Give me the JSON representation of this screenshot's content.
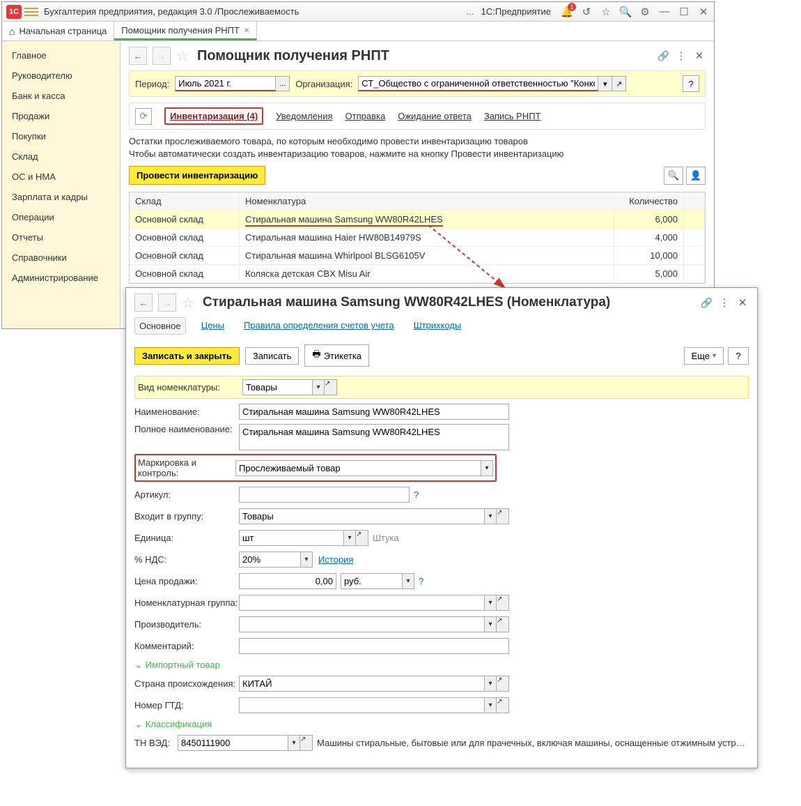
{
  "titlebar": {
    "app": "Бухгалтерия предприятия, редакция 3.0 /Прослеживаемость",
    "platform": "1С:Предприятие",
    "bell_count": "1"
  },
  "tabs": {
    "home": "Начальная страница",
    "t1": "Помощник получения РНПТ"
  },
  "sidebar": {
    "items": [
      "Главное",
      "Руководителю",
      "Банк и касса",
      "Продажи",
      "Покупки",
      "Склад",
      "ОС и НМА",
      "Зарплата и кадры",
      "Операции",
      "Отчеты",
      "Справочники",
      "Администрирование"
    ]
  },
  "page1": {
    "title": "Помощник получения РНПТ",
    "period_lbl": "Период:",
    "period_val": "Июль 2021 г.",
    "org_lbl": "Организация:",
    "org_val": "СТ_Общество с ограниченной ответственностью \"Конкорд\"",
    "tabs": {
      "inv": "Инвентаризация (4)",
      "notif": "Уведомления",
      "send": "Отправка",
      "wait": "Ожидание ответа",
      "rec": "Запись РНПТ"
    },
    "info1": "Остатки прослеживаемого товара, по которым необходимо провести инвентаризацию товаров",
    "info2": "Чтобы автоматически создать инвентаризацию товаров, нажмите на кнопку Провести инвентаризацию",
    "action": "Провести инвентаризацию",
    "cols": {
      "c1": "Склад",
      "c2": "Номенклатура",
      "c3": "Количество"
    },
    "rows": [
      {
        "c1": "Основной склад",
        "c2": "Стиральная машина Samsung WW80R42LHES",
        "c3": "6,000"
      },
      {
        "c1": "Основной склад",
        "c2": "Стиральная машина Haier HW80B14979S",
        "c3": "4,000"
      },
      {
        "c1": "Основной склад",
        "c2": "Стиральная машина Whirlpool BLSG6105V",
        "c3": "10,000"
      },
      {
        "c1": "Основной склад",
        "c2": "Коляска детская CBX Misu Air",
        "c3": "5,000"
      }
    ]
  },
  "page2": {
    "title": "Стиральная машина Samsung WW80R42LHES (Номенклатура)",
    "tabs": {
      "main": "Основное",
      "prices": "Цены",
      "rules": "Правила определения счетов учета",
      "barcodes": "Штрихкоды"
    },
    "cmd": {
      "saveclose": "Записать и закрыть",
      "save": "Записать",
      "label": "Этикетка",
      "more": "Еще",
      "help": "?"
    },
    "fields": {
      "vid_lbl": "Вид номенклатуры:",
      "vid_val": "Товары",
      "name_lbl": "Наименование:",
      "name_val": "Стиральная машина Samsung WW80R42LHES",
      "full_lbl": "Полное наименование:",
      "full_val": "Стиральная машина Samsung WW80R42LHES",
      "mark_lbl": "Маркировка и контроль:",
      "mark_val": "Прослеживаемый товар",
      "art_lbl": "Артикул:",
      "art_val": "",
      "grp_lbl": "Входит в группу:",
      "grp_val": "Товары",
      "unit_lbl": "Единица:",
      "unit_val": "шт",
      "unit_hint": "Штука",
      "vat_lbl": "% НДС:",
      "vat_val": "20%",
      "vat_link": "История",
      "price_lbl": "Цена продажи:",
      "price_val": "0,00",
      "price_cur": "руб.",
      "nomgrp_lbl": "Номенклатурная группа:",
      "nomgrp_val": "",
      "prod_lbl": "Производитель:",
      "prod_val": "",
      "comm_lbl": "Комментарий:",
      "comm_val": "",
      "import_hdr": "Импортный товар",
      "country_lbl": "Страна происхождения:",
      "country_val": "КИТАЙ",
      "gtd_lbl": "Номер ГТД:",
      "gtd_val": "",
      "class_hdr": "Классификация",
      "tnved_lbl": "ТН ВЭД:",
      "tnved_val": "8450111900",
      "tnved_desc": "Машины стиральные, бытовые или для прачечных, включая машины, оснащенные отжимным устройством..."
    }
  }
}
